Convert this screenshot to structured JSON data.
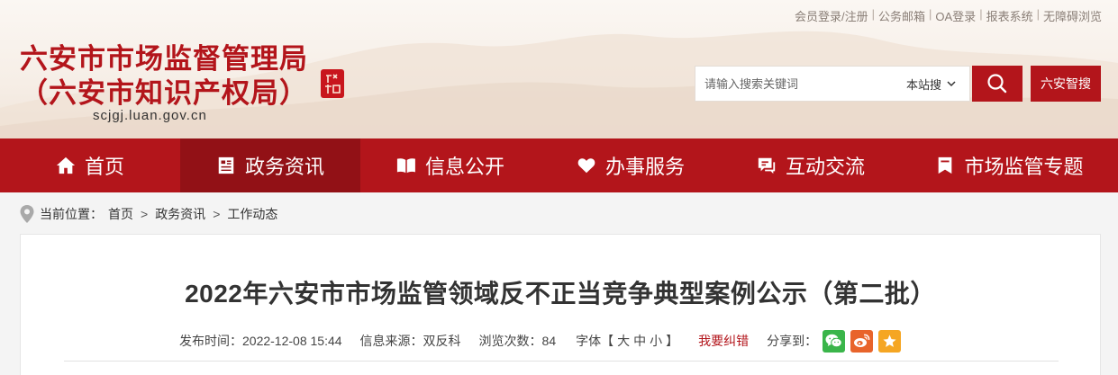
{
  "top_links": [
    "会员登录/注册",
    "公务邮箱",
    "OA登录",
    "报表系统",
    "无障碍浏览"
  ],
  "logo": {
    "line1": "六安市市场监督管理局",
    "line2": "（六安市知识产权局）",
    "url": "scjgj.luan.gov.cn"
  },
  "search": {
    "placeholder": "请输入搜索关键词",
    "scope": "本站搜",
    "smart_label": "六安智搜"
  },
  "nav": [
    {
      "label": "首页",
      "icon": "home-icon"
    },
    {
      "label": "政务资讯",
      "icon": "news-icon"
    },
    {
      "label": "信息公开",
      "icon": "book-icon"
    },
    {
      "label": "办事服务",
      "icon": "heart-icon"
    },
    {
      "label": "互动交流",
      "icon": "chat-icon"
    },
    {
      "label": "市场监管专题",
      "icon": "bookmark-icon"
    }
  ],
  "breadcrumb": {
    "prefix": "当前位置：",
    "items": [
      "首页",
      "政务资讯",
      "工作动态"
    ],
    "separator": ">"
  },
  "article": {
    "title": "2022年六安市市场监管领域反不正当竞争典型案例公示（第二批）",
    "publish_time": "发布时间：2022-12-08 15:44",
    "source": "信息来源：双反科",
    "views": "浏览次数：84",
    "font_label": "字体【",
    "font_sizes": [
      "大",
      "中",
      "小"
    ],
    "font_close": "】",
    "report": "我要纠错",
    "share_label": "分享到："
  },
  "colors": {
    "brand": "#b3151b",
    "nav_active": "#921116",
    "wechat": "#3ab54a",
    "weibo": "#e8642b",
    "qzone": "#f5a623"
  }
}
